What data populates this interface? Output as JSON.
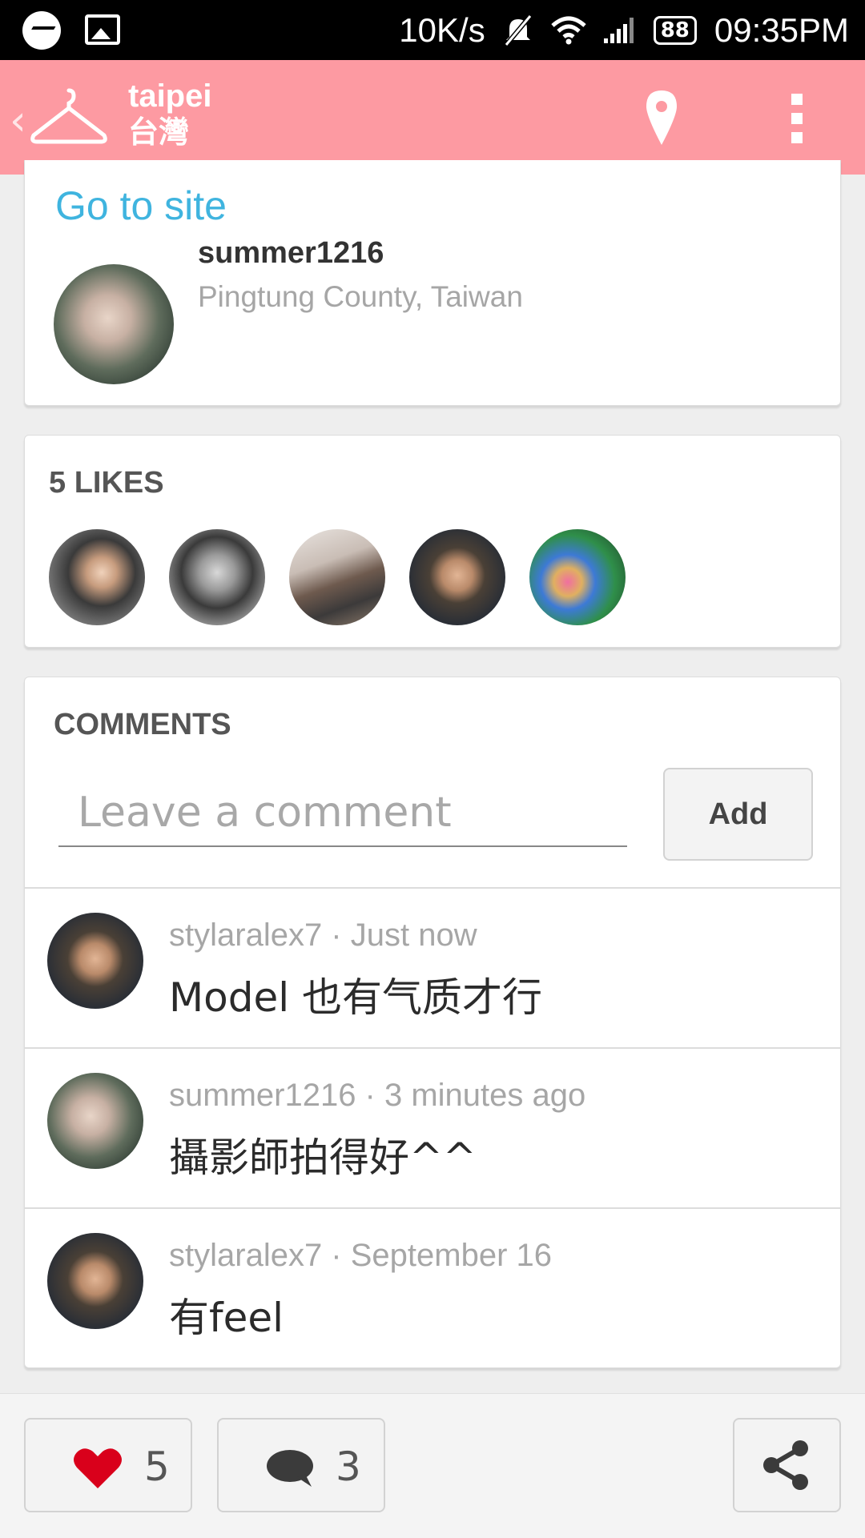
{
  "status_bar": {
    "net_speed": "10K/s",
    "battery": "88",
    "time": "09:35PM",
    "icons": [
      "messenger-icon",
      "image-icon",
      "mute-icon",
      "wifi-icon",
      "signal-icon",
      "battery-icon"
    ]
  },
  "app_bar": {
    "title": "taipei",
    "subtitle": "台灣",
    "background_color": "#fd9aa2",
    "icons": [
      "back-chevron-icon",
      "hanger-icon",
      "location-pin-icon",
      "overflow-menu-icon"
    ]
  },
  "post": {
    "link_label": "Go to site",
    "owner_name": "summer1216",
    "owner_location": "Pingtung County, Taiwan"
  },
  "likes": {
    "heading": "5 LIKES"
  },
  "comments": {
    "heading": "COMMENTS",
    "input_placeholder": "Leave a comment",
    "add_label": "Add",
    "items": [
      {
        "meta": "stylaralex7 ·  Just now",
        "text": "Model 也有气质才行"
      },
      {
        "meta": "summer1216 · 3 minutes ago",
        "text": "攝影師拍得好^^"
      },
      {
        "meta": "stylaralex7 · September 16",
        "text": "有feel"
      }
    ]
  },
  "bottom_bar": {
    "like_count": "5",
    "comment_count": "3"
  },
  "colors": {
    "accent_pink": "#fd9aa2",
    "link_blue": "#3fb4df",
    "heart_red": "#d9001b"
  }
}
